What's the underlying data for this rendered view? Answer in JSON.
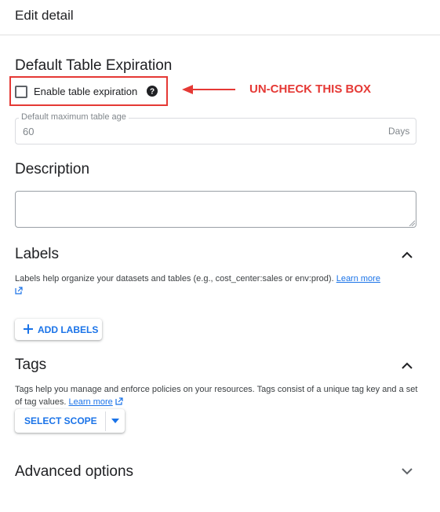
{
  "header": {
    "title": "Edit detail"
  },
  "expiration": {
    "title": "Default Table Expiration",
    "checkbox_label": "Enable table expiration",
    "checkbox_checked": false,
    "field_label": "Default maximum table age",
    "field_value": "60",
    "field_suffix": "Days",
    "annotation": "UN-CHECK THIS BOX"
  },
  "description": {
    "title": "Description",
    "value": ""
  },
  "labels": {
    "title": "Labels",
    "text": "Labels help organize your datasets and tables (e.g., cost_center:sales or env:prod).",
    "link": "Learn more",
    "button": "ADD LABELS"
  },
  "tags": {
    "title": "Tags",
    "text": "Tags help you manage and enforce policies on your resources. Tags consist of a unique tag key and a set of tag values.",
    "link": "Learn more",
    "button": "SELECT SCOPE"
  },
  "advanced": {
    "title": "Advanced options"
  },
  "colors": {
    "accent": "#1a73e8",
    "annotation": "#e53935"
  }
}
